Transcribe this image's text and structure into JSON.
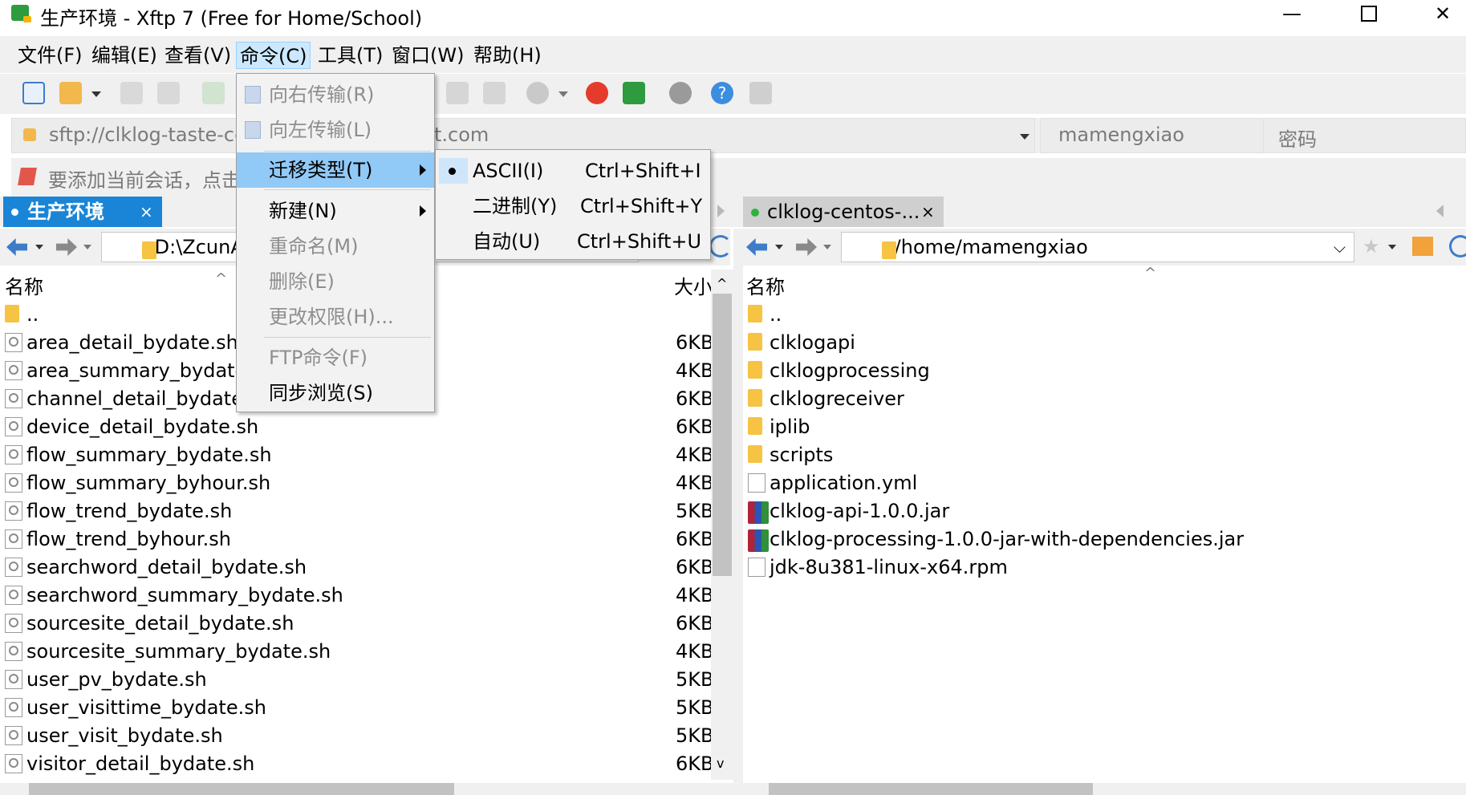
{
  "window": {
    "title": "生产环境 - Xftp 7 (Free for Home/School)",
    "min_glyph": "—",
    "max_glyph": "☐",
    "close_glyph": "✕"
  },
  "menubar": {
    "file": "文件(F)",
    "edit": "编辑(E)",
    "view": "查看(V)",
    "command": "命令(C)",
    "tools": "工具(T)",
    "window": "窗口(W)",
    "help": "帮助(H)"
  },
  "address": {
    "url_visible": "sftp://clklog-taste-ce",
    "url_tail": "t.com",
    "username": "mamengxiao",
    "password_placeholder": "密码"
  },
  "hint": {
    "text": "要添加当前会话，点击"
  },
  "tabs": {
    "left": "生产环境",
    "right": "clklog-centos-...",
    "close": "×"
  },
  "left_pane": {
    "path": "D:\\ZcunApi",
    "col_name": "名称",
    "col_size": "大小",
    "parent": "..",
    "files": [
      {
        "name": "area_detail_bydate.sh",
        "size": "6KB"
      },
      {
        "name": "area_summary_bydate",
        "size": "4KB"
      },
      {
        "name": "channel_detail_bydate",
        "size": "6KB"
      },
      {
        "name": "device_detail_bydate.sh",
        "size": "6KB"
      },
      {
        "name": "flow_summary_bydate.sh",
        "size": "4KB"
      },
      {
        "name": "flow_summary_byhour.sh",
        "size": "4KB"
      },
      {
        "name": "flow_trend_bydate.sh",
        "size": "5KB"
      },
      {
        "name": "flow_trend_byhour.sh",
        "size": "6KB"
      },
      {
        "name": "searchword_detail_bydate.sh",
        "size": "6KB"
      },
      {
        "name": "searchword_summary_bydate.sh",
        "size": "4KB"
      },
      {
        "name": "sourcesite_detail_bydate.sh",
        "size": "6KB"
      },
      {
        "name": "sourcesite_summary_bydate.sh",
        "size": "4KB"
      },
      {
        "name": "user_pv_bydate.sh",
        "size": "5KB"
      },
      {
        "name": "user_visittime_bydate.sh",
        "size": "5KB"
      },
      {
        "name": "user_visit_bydate.sh",
        "size": "5KB"
      },
      {
        "name": "visitor_detail_bydate.sh",
        "size": "6KB"
      }
    ]
  },
  "right_pane": {
    "path": "/home/mamengxiao",
    "col_name": "名称",
    "parent": "..",
    "items": [
      {
        "name": "clklogapi",
        "type": "folder"
      },
      {
        "name": "clklogprocessing",
        "type": "folder"
      },
      {
        "name": "clklogreceiver",
        "type": "folder"
      },
      {
        "name": "iplib",
        "type": "folder"
      },
      {
        "name": "scripts",
        "type": "folder"
      },
      {
        "name": "application.yml",
        "type": "file"
      },
      {
        "name": "clklog-api-1.0.0.jar",
        "type": "jar"
      },
      {
        "name": "clklog-processing-1.0.0-jar-with-dependencies.jar",
        "type": "jar"
      },
      {
        "name": "jdk-8u381-linux-x64.rpm",
        "type": "file"
      }
    ]
  },
  "command_menu": {
    "transfer_right": "向右传输(R)",
    "transfer_left": "向左传输(L)",
    "transfer_type": "迁移类型(T)",
    "new": "新建(N)",
    "rename": "重命名(M)",
    "delete": "删除(E)",
    "permissions": "更改权限(H)...",
    "ftp_command": "FTP命令(F)",
    "sync_browse": "同步浏览(S)"
  },
  "transfer_submenu": {
    "ascii": "ASCII(I)",
    "ascii_shortcut": "Ctrl+Shift+I",
    "binary": "二进制(Y)",
    "binary_shortcut": "Ctrl+Shift+Y",
    "auto": "自动(U)",
    "auto_shortcut": "Ctrl+Shift+U",
    "selected": "ASCII(I)"
  },
  "colors": {
    "accent": "#0a7ee0",
    "menu_highlight": "#91c9f7",
    "active_tab": "#1a85d6"
  }
}
